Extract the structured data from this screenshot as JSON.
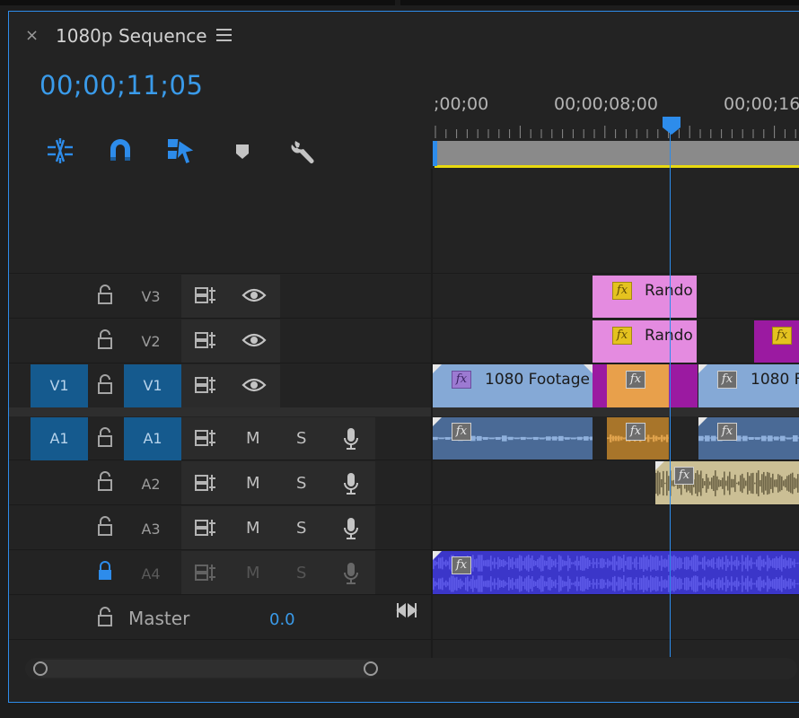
{
  "panel": {
    "close_symbol": "×",
    "title": "1080p Sequence",
    "menu_icon": "hamburger-menu-icon",
    "timecode": "00;00;11;05",
    "accent_color": "#2d8ceb"
  },
  "toolbar": {
    "tools": [
      {
        "icon": "insert-overwrite-nest-icon",
        "active": true
      },
      {
        "icon": "snap-magnet-icon",
        "active": true
      },
      {
        "icon": "linked-selection-icon",
        "active": true
      },
      {
        "icon": "add-marker-icon",
        "active": false
      },
      {
        "icon": "timeline-settings-wrench-icon",
        "active": false
      }
    ]
  },
  "ruler": {
    "labels": [
      ";00;00",
      "00;00;08;00",
      "00;00;16"
    ]
  },
  "tracks": {
    "video": [
      {
        "name": "V3",
        "source_patch": "",
        "locked": false
      },
      {
        "name": "V2",
        "source_patch": "",
        "locked": false
      },
      {
        "name": "V1",
        "source_patch": "V1",
        "locked": false
      }
    ],
    "audio": [
      {
        "name": "A1",
        "source_patch": "A1",
        "locked": false,
        "mute": "M",
        "solo": "S"
      },
      {
        "name": "A2",
        "source_patch": "",
        "locked": false,
        "mute": "M",
        "solo": "S"
      },
      {
        "name": "A3",
        "source_patch": "",
        "locked": false,
        "mute": "M",
        "solo": "S"
      },
      {
        "name": "A4",
        "source_patch": "",
        "locked": true,
        "mute": "M",
        "solo": "S"
      }
    ],
    "master": {
      "label": "Master",
      "value": "0.0"
    }
  },
  "clips": {
    "fx_label": "fx",
    "v3_clip": {
      "name": "Rando",
      "color": "#e48be0"
    },
    "v2_clip": {
      "name": "Rando",
      "color": "#e48be0"
    },
    "v2_clip2": {
      "name": "",
      "color": "#9b1aa1"
    },
    "v1_clip1": {
      "name": "1080 Footage",
      "color": "#85a9d6"
    },
    "v1_clip2": {
      "name": "",
      "color": "#e8a04b"
    },
    "v1_clip3": {
      "name": "1080 F",
      "color": "#85a9d6"
    },
    "v1_gap_color": "#9b1aa1",
    "a1_color": "#4a6a96",
    "a1_orange": "#a8752a",
    "a2_color": "#cbbf95",
    "a4_color": "#3b36c9"
  }
}
